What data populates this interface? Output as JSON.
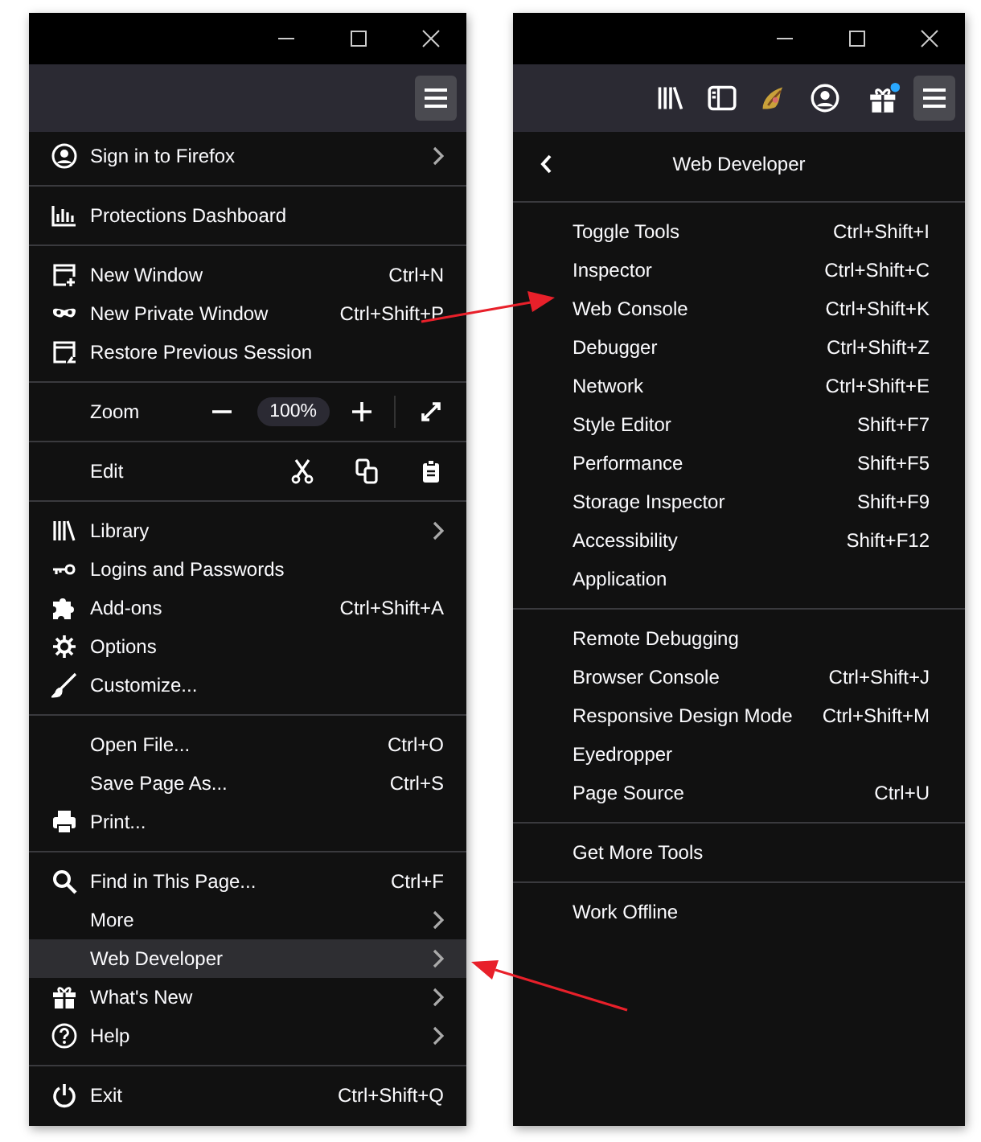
{
  "main_menu": {
    "sections": [
      {
        "items": [
          {
            "kind": "item",
            "label": "Sign in to Firefox",
            "submenu": true,
            "selected": false
          }
        ]
      },
      {
        "items": [
          {
            "kind": "item",
            "label": "Protections Dashboard",
            "submenu": false,
            "selected": false
          }
        ]
      },
      {
        "items": [
          {
            "kind": "item",
            "label": "New Window",
            "shortcut": "Ctrl+N",
            "submenu": false,
            "selected": false
          },
          {
            "kind": "item",
            "label": "New Private Window",
            "shortcut": "Ctrl+Shift+P",
            "submenu": false,
            "selected": false
          },
          {
            "kind": "item",
            "label": "Restore Previous Session",
            "submenu": false,
            "selected": false
          }
        ]
      },
      {
        "items": [
          {
            "kind": "zoom",
            "label": "Zoom",
            "value": "100%"
          }
        ]
      },
      {
        "items": [
          {
            "kind": "edit",
            "label": "Edit"
          }
        ]
      },
      {
        "items": [
          {
            "kind": "item",
            "label": "Library",
            "submenu": true,
            "selected": false
          },
          {
            "kind": "item",
            "label": "Logins and Passwords",
            "submenu": false,
            "selected": false
          },
          {
            "kind": "item",
            "label": "Add-ons",
            "shortcut": "Ctrl+Shift+A",
            "submenu": false,
            "selected": false
          },
          {
            "kind": "item",
            "label": "Options",
            "submenu": false,
            "selected": false
          },
          {
            "kind": "item",
            "label": "Customize...",
            "submenu": false,
            "selected": false
          }
        ]
      },
      {
        "items": [
          {
            "kind": "item",
            "label": "Open File...",
            "shortcut": "Ctrl+O",
            "submenu": false,
            "selected": false
          },
          {
            "kind": "item",
            "label": "Save Page As...",
            "shortcut": "Ctrl+S",
            "submenu": false,
            "selected": false
          },
          {
            "kind": "item",
            "label": "Print...",
            "submenu": false,
            "selected": false
          }
        ]
      },
      {
        "items": [
          {
            "kind": "item",
            "label": "Find in This Page...",
            "shortcut": "Ctrl+F",
            "submenu": false,
            "selected": false
          },
          {
            "kind": "item",
            "label": "More",
            "submenu": true,
            "selected": false
          },
          {
            "kind": "item",
            "label": "Web Developer",
            "submenu": true,
            "selected": true
          },
          {
            "kind": "item",
            "label": "What's New",
            "submenu": true,
            "selected": false
          },
          {
            "kind": "item",
            "label": "Help",
            "submenu": true,
            "selected": false
          }
        ]
      },
      {
        "items": [
          {
            "kind": "item",
            "label": "Exit",
            "shortcut": "Ctrl+Shift+Q",
            "submenu": false,
            "selected": false
          }
        ]
      }
    ]
  },
  "web_developer_menu": {
    "title": "Web Developer",
    "sections": [
      {
        "items": [
          {
            "label": "Toggle Tools",
            "shortcut": "Ctrl+Shift+I"
          },
          {
            "label": "Inspector",
            "shortcut": "Ctrl+Shift+C"
          },
          {
            "label": "Web Console",
            "shortcut": "Ctrl+Shift+K"
          },
          {
            "label": "Debugger",
            "shortcut": "Ctrl+Shift+Z"
          },
          {
            "label": "Network",
            "shortcut": "Ctrl+Shift+E"
          },
          {
            "label": "Style Editor",
            "shortcut": "Shift+F7"
          },
          {
            "label": "Performance",
            "shortcut": "Shift+F5"
          },
          {
            "label": "Storage Inspector",
            "shortcut": "Shift+F9"
          },
          {
            "label": "Accessibility",
            "shortcut": "Shift+F12"
          },
          {
            "label": "Application"
          }
        ]
      },
      {
        "items": [
          {
            "label": "Remote Debugging"
          },
          {
            "label": "Browser Console",
            "shortcut": "Ctrl+Shift+J"
          },
          {
            "label": "Responsive Design Mode",
            "shortcut": "Ctrl+Shift+M"
          },
          {
            "label": "Eyedropper"
          },
          {
            "label": "Page Source",
            "shortcut": "Ctrl+U"
          }
        ]
      },
      {
        "items": [
          {
            "label": "Get More Tools"
          }
        ]
      },
      {
        "items": [
          {
            "label": "Work Offline"
          }
        ]
      }
    ]
  }
}
